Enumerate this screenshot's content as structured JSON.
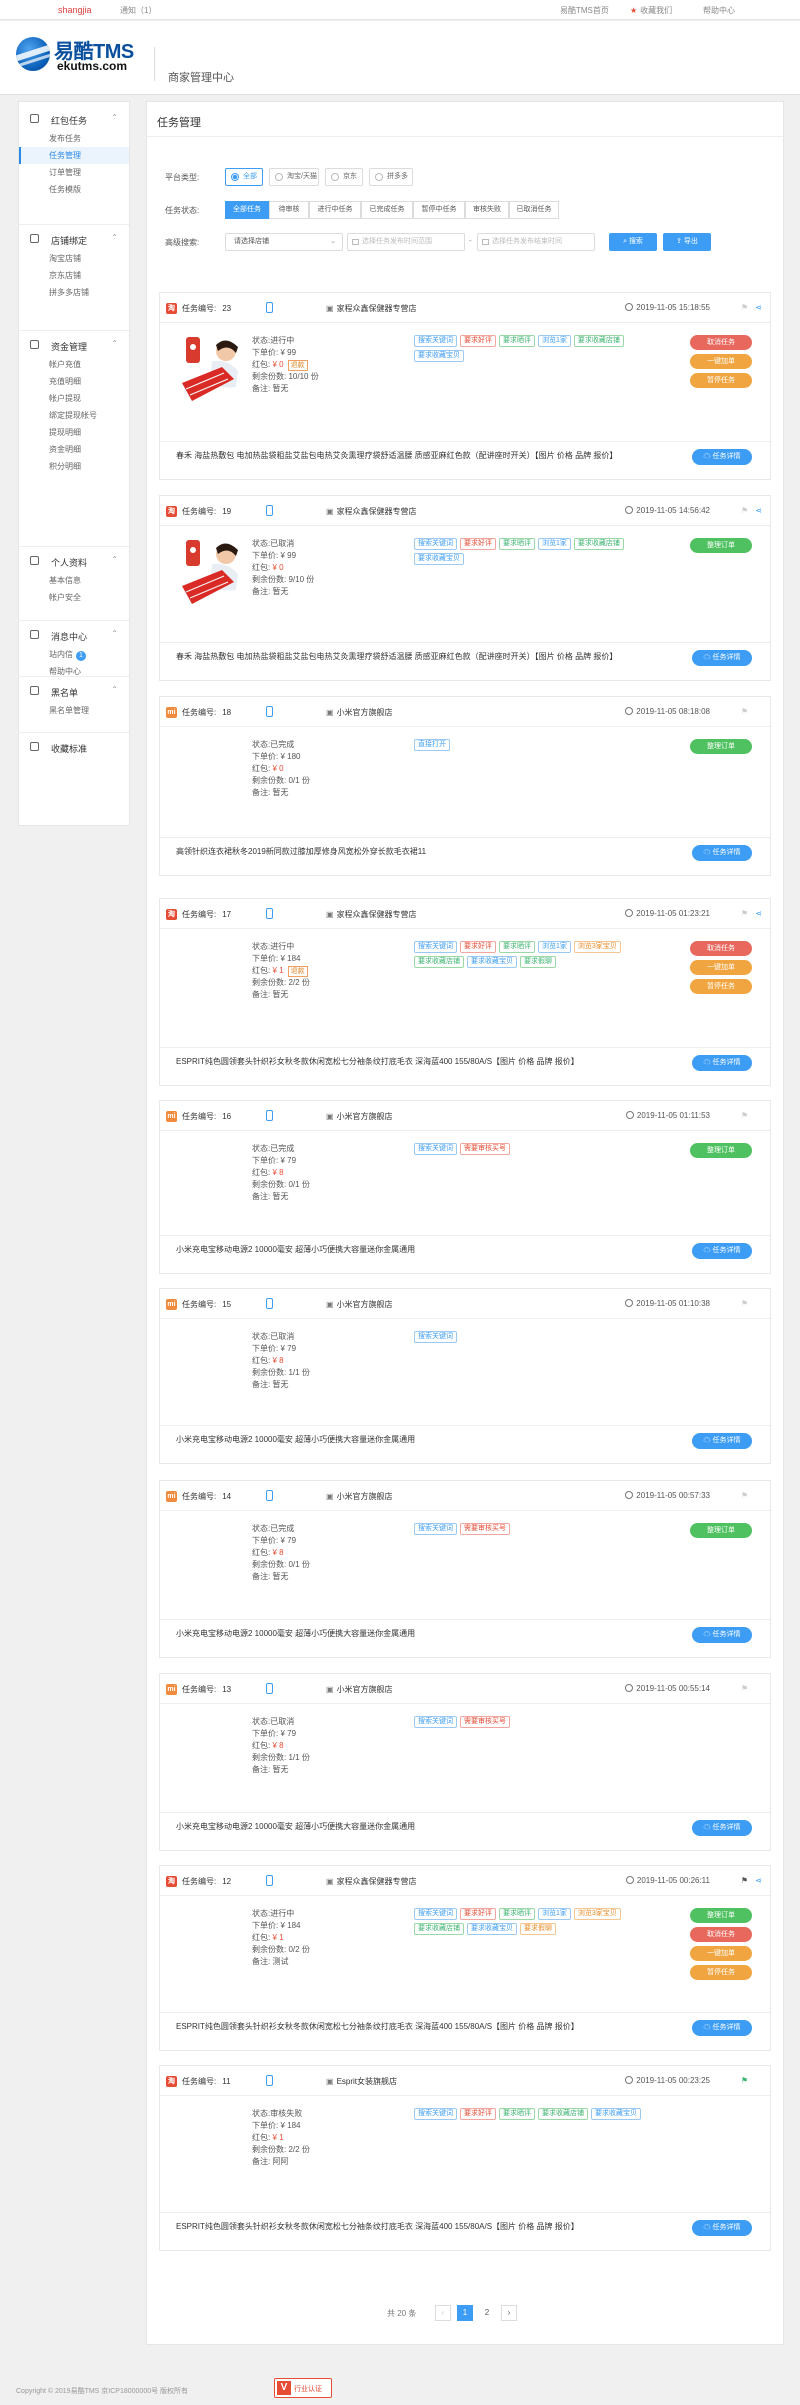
{
  "topbar": {
    "username": "shangjia",
    "notice": "通知（1）",
    "home_link": "易酷TMS首页",
    "favorite": "收藏我们",
    "help": "帮助中心"
  },
  "header": {
    "logo_text": "易酷TMS",
    "logo_url": "ekutms.com",
    "center_title": "商家管理中心"
  },
  "sidebar": {
    "groups": [
      {
        "label": "红包任务",
        "icon": "gift-icon",
        "items": [
          "发布任务",
          "任务管理",
          "订单管理",
          "任务模版"
        ]
      },
      {
        "label": "店铺绑定",
        "icon": "store-icon",
        "items": [
          "淘宝店铺",
          "京东店铺",
          "拼多多店铺"
        ]
      },
      {
        "label": "资金管理",
        "icon": "wallet-icon",
        "items": [
          "帐户充值",
          "充值明细",
          "帐户提现",
          "绑定提现帐号",
          "提现明细",
          "资金明细",
          "积分明细"
        ]
      },
      {
        "label": "个人资料",
        "icon": "user-icon",
        "items": [
          "基本信息",
          "帐户安全"
        ]
      },
      {
        "label": "消息中心",
        "icon": "bell-icon",
        "items": [
          "站内信",
          "帮助中心"
        ]
      },
      {
        "label": "黑名单",
        "icon": "block-icon",
        "items": [
          "黑名单管理"
        ]
      }
    ],
    "inbox_badge": "1",
    "standalone": "收藏标准",
    "active_item": "任务管理"
  },
  "main": {
    "title": "任务管理",
    "filters": {
      "platform_label": "平台类型:",
      "platform_options": [
        "全部",
        "淘宝/天猫",
        "京东",
        "拼多多"
      ],
      "status_label": "任务状态:",
      "status_tabs": [
        "全部任务",
        "待审核",
        "进行中任务",
        "已完成任务",
        "暂停中任务",
        "审核失败",
        "已取消任务"
      ],
      "search_label": "高级搜索:",
      "shop_select": "请选择店铺",
      "start_placeholder": "选择任务发布时间范围",
      "end_placeholder": "选择任务发布结束时间",
      "search_btn": "搜索",
      "export_btn": "导出"
    },
    "labels": {
      "task_no": "任务编号:",
      "status": "状态:",
      "unit_price": "下单价:",
      "redpack": "红包:",
      "remaining": "剩余份数:",
      "remark": "备注:",
      "detail_btn": "任务详情"
    },
    "tasks": [
      {
        "no": "23",
        "platform": "taobao",
        "shop": "家程众鑫保健器专营店",
        "time": "2019-11-05 15:18:55",
        "status": "进行中",
        "price": "¥ 99",
        "redpack": "¥ 0",
        "refund_tag": "退款",
        "remaining": "10/10 份",
        "remark": "暂无",
        "has_thumb": true,
        "share": true,
        "flag": "light",
        "tags": [
          {
            "t": "搜索关键词",
            "c": "b"
          },
          {
            "t": "要求好评",
            "c": "r"
          },
          {
            "t": "要求晒评",
            "c": "g"
          },
          {
            "t": "浏览1家",
            "c": "b"
          },
          {
            "t": "要求收藏店铺",
            "c": "g"
          },
          {
            "t": "要求收藏宝贝",
            "c": "b"
          }
        ],
        "actions": [
          {
            "t": "取消任务",
            "c": "red"
          },
          {
            "t": "一键加单",
            "c": "orange"
          },
          {
            "t": "暂停任务",
            "c": "orange"
          }
        ],
        "title": "春禾 海盐热敷包 电加热盐袋粗盐艾盐包电热艾灸熏理疗袋舒适温腰 质感亚麻红色款（配讲座时开关）【图片 价格 品牌 报价】"
      },
      {
        "no": "19",
        "platform": "taobao",
        "shop": "家程众鑫保健器专营店",
        "time": "2019-11-05 14:56:42",
        "status": "已取消",
        "price": "¥ 99",
        "redpack": "¥ 0",
        "remaining": "9/10 份",
        "remark": "暂无",
        "has_thumb": true,
        "share": true,
        "flag": "light",
        "tags": [
          {
            "t": "搜索关键词",
            "c": "b"
          },
          {
            "t": "要求好评",
            "c": "r"
          },
          {
            "t": "要求晒评",
            "c": "g"
          },
          {
            "t": "浏览1家",
            "c": "b"
          },
          {
            "t": "要求收藏店铺",
            "c": "g"
          },
          {
            "t": "要求收藏宝贝",
            "c": "b"
          }
        ],
        "actions": [
          {
            "t": "整理订单",
            "c": "green"
          }
        ],
        "title": "春禾 海盐热敷包 电加热盐袋粗盐艾盐包电热艾灸熏理疗袋舒适温腰 质感亚麻红色款（配讲座时开关）【图片 价格 品牌 报价】"
      },
      {
        "no": "18",
        "platform": "mi",
        "shop": "小米官方旗舰店",
        "time": "2019-11-05 08:18:08",
        "status": "已完成",
        "price": "¥ 180",
        "redpack": "¥ 0",
        "remaining": "0/1 份",
        "remark": "暂无",
        "has_thumb": false,
        "share": false,
        "flag": "light",
        "tags": [
          {
            "t": "直接打开",
            "c": "b"
          }
        ],
        "actions": [
          {
            "t": "整理订单",
            "c": "green"
          }
        ],
        "title": "高领针织连衣裙秋冬2019新同款过膝加厚修身风宽松外穿长款毛衣裙11"
      },
      {
        "no": "17",
        "platform": "taobao",
        "shop": "家程众鑫保健器专营店",
        "time": "2019-11-05 01:23:21",
        "status": "进行中",
        "price": "¥ 184",
        "redpack": "¥ 1",
        "refund_tag": "退款",
        "remaining": "2/2 份",
        "remark": "暂无",
        "has_thumb": false,
        "share": true,
        "flag": "light",
        "tags": [
          {
            "t": "搜索关键词",
            "c": "b"
          },
          {
            "t": "要求好评",
            "c": "r"
          },
          {
            "t": "要求晒评",
            "c": "g"
          },
          {
            "t": "浏览1家",
            "c": "b"
          },
          {
            "t": "浏览3家宝贝",
            "c": "o"
          },
          {
            "t": "要求收藏店铺",
            "c": "g"
          },
          {
            "t": "要求收藏宝贝",
            "c": "b"
          },
          {
            "t": "要求假聊",
            "c": "g"
          }
        ],
        "actions": [
          {
            "t": "取消任务",
            "c": "red"
          },
          {
            "t": "一键加单",
            "c": "orange"
          },
          {
            "t": "暂停任务",
            "c": "orange"
          }
        ],
        "title": "ESPRIT纯色圆领套头针织衫女秋冬款休闲宽松七分袖条纹打底毛衣 深海蓝400 155/80A/S【图片 价格 品牌 报价】"
      },
      {
        "no": "16",
        "platform": "mi",
        "shop": "小米官方旗舰店",
        "time": "2019-11-05 01:11:53",
        "status": "已完成",
        "price": "¥ 79",
        "redpack": "¥ 8",
        "remaining": "0/1 份",
        "remark": "暂无",
        "has_thumb": false,
        "share": false,
        "flag": "light",
        "tags": [
          {
            "t": "搜索关键词",
            "c": "b"
          },
          {
            "t": "需要审核买号",
            "c": "r"
          }
        ],
        "actions": [
          {
            "t": "整理订单",
            "c": "green"
          }
        ],
        "title": "小米充电宝移动电源2 10000毫安 超薄小巧便携大容量迷你金属通用"
      },
      {
        "no": "15",
        "platform": "mi",
        "shop": "小米官方旗舰店",
        "time": "2019-11-05 01:10:38",
        "status": "已取消",
        "price": "¥ 79",
        "redpack": "¥ 8",
        "remaining": "1/1 份",
        "remark": "暂无",
        "has_thumb": false,
        "share": false,
        "flag": "light",
        "tags": [
          {
            "t": "搜索关键词",
            "c": "b"
          }
        ],
        "actions": [],
        "title": "小米充电宝移动电源2 10000毫安 超薄小巧便携大容量迷你金属通用"
      },
      {
        "no": "14",
        "platform": "mi",
        "shop": "小米官方旗舰店",
        "time": "2019-11-05 00:57:33",
        "status": "已完成",
        "price": "¥ 79",
        "redpack": "¥ 8",
        "remaining": "0/1 份",
        "remark": "暂无",
        "has_thumb": false,
        "share": false,
        "flag": "light",
        "tags": [
          {
            "t": "搜索关键词",
            "c": "b"
          },
          {
            "t": "需要审核买号",
            "c": "r"
          }
        ],
        "actions": [
          {
            "t": "整理订单",
            "c": "green"
          }
        ],
        "title": "小米充电宝移动电源2 10000毫安 超薄小巧便携大容量迷你金属通用"
      },
      {
        "no": "13",
        "platform": "mi",
        "shop": "小米官方旗舰店",
        "time": "2019-11-05 00:55:14",
        "status": "已取消",
        "price": "¥ 79",
        "redpack": "¥ 8",
        "remaining": "1/1 份",
        "remark": "暂无",
        "has_thumb": false,
        "share": false,
        "flag": "light",
        "tags": [
          {
            "t": "搜索关键词",
            "c": "b"
          },
          {
            "t": "需要审核买号",
            "c": "r"
          }
        ],
        "actions": [],
        "title": "小米充电宝移动电源2 10000毫安 超薄小巧便携大容量迷你金属通用"
      },
      {
        "no": "12",
        "platform": "taobao",
        "shop": "家程众鑫保健器专营店",
        "time": "2019-11-05 00:26:11",
        "status": "进行中",
        "price": "¥ 184",
        "redpack": "¥ 1",
        "remaining": "0/2 份",
        "remark": "测试",
        "has_thumb": false,
        "share": true,
        "flag": "dark",
        "tags": [
          {
            "t": "搜索关键词",
            "c": "b"
          },
          {
            "t": "要求好评",
            "c": "r"
          },
          {
            "t": "要求晒评",
            "c": "g"
          },
          {
            "t": "浏览1家",
            "c": "b"
          },
          {
            "t": "浏览3家宝贝",
            "c": "o"
          },
          {
            "t": "要求收藏店铺",
            "c": "g"
          },
          {
            "t": "要求收藏宝贝",
            "c": "b"
          },
          {
            "t": "要求假聊",
            "c": "o"
          }
        ],
        "actions": [
          {
            "t": "整理订单",
            "c": "green"
          },
          {
            "t": "取消任务",
            "c": "red"
          },
          {
            "t": "一键加单",
            "c": "orange"
          },
          {
            "t": "暂停任务",
            "c": "orange"
          }
        ],
        "title": "ESPRIT纯色圆领套头针织衫女秋冬款休闲宽松七分袖条纹打底毛衣 深海蓝400 155/80A/S【图片 价格 品牌 报价】"
      },
      {
        "no": "11",
        "platform": "taobao",
        "shop": "Esprit女装旗舰店",
        "time": "2019-11-05 00:23:25",
        "status": "审核失败",
        "price": "¥ 184",
        "redpack": "¥ 1",
        "remaining": "2/2 份",
        "remark": "阿阿",
        "has_thumb": false,
        "share": false,
        "flag": "green",
        "tags": [
          {
            "t": "搜索关键词",
            "c": "b"
          },
          {
            "t": "要求好评",
            "c": "r"
          },
          {
            "t": "要求晒评",
            "c": "g"
          },
          {
            "t": "要求收藏店铺",
            "c": "g"
          },
          {
            "t": "要求收藏宝贝",
            "c": "b"
          }
        ],
        "actions": [],
        "title": "ESPRIT纯色圆领套头针织衫女秋冬款休闲宽松七分袖条纹打底毛衣 深海蓝400 155/80A/S【图片 价格 品牌 报价】"
      }
    ],
    "pagination": {
      "total": "共 20 条",
      "prev": "‹",
      "pages": [
        "1",
        "2"
      ],
      "current": "1",
      "next": "›"
    }
  },
  "footer": {
    "copyright": "Copyright © 2019易酷TMS  京ICP18000000号  版权所有",
    "badge_text": "行业认证"
  },
  "colors": {
    "accent": "#3d9df4",
    "danger": "#e8685e",
    "warning": "#f0a540",
    "success": "#4fc161",
    "brand": "#0a4f9e"
  }
}
